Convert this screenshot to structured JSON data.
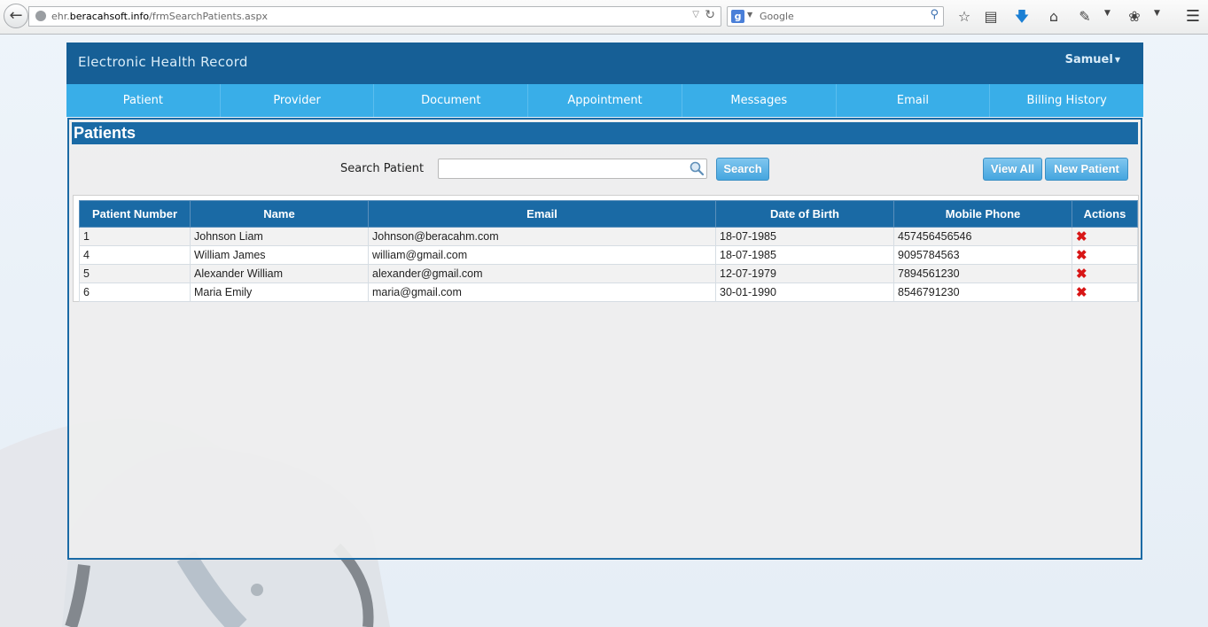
{
  "browser": {
    "url_prefix": "ehr.",
    "url_host": "beracahsoft.info",
    "url_path": "/frmSearchPatients.aspx",
    "search_engine_icon": "google-icon",
    "search_placeholder": "Google"
  },
  "header": {
    "title": "Electronic Health Record",
    "user": "Samuel"
  },
  "nav": {
    "items": [
      {
        "label": "Patient"
      },
      {
        "label": "Provider"
      },
      {
        "label": "Document"
      },
      {
        "label": "Appointment"
      },
      {
        "label": "Messages"
      },
      {
        "label": "Email"
      },
      {
        "label": "Billing History"
      }
    ]
  },
  "panel": {
    "title": "Patients",
    "search_label": "Search Patient",
    "search_value": "",
    "search_button": "Search",
    "view_all_button": "View All",
    "new_patient_button": "New Patient"
  },
  "table": {
    "headers": [
      "Patient Number",
      "Name",
      "Email",
      "Date of Birth",
      "Mobile Phone",
      "Actions"
    ],
    "rows": [
      {
        "number": "1",
        "name": "Johnson Liam",
        "email": "Johnson@beracahm.com",
        "dob": "18-07-1985",
        "phone": "457456456546"
      },
      {
        "number": "4",
        "name": "William James",
        "email": "william@gmail.com",
        "dob": "18-07-1985",
        "phone": "9095784563"
      },
      {
        "number": "5",
        "name": "Alexander William",
        "email": "alexander@gmail.com",
        "dob": "12-07-1979",
        "phone": "7894561230"
      },
      {
        "number": "6",
        "name": "Maria Emily",
        "email": "maria@gmail.com",
        "dob": "30-01-1990",
        "phone": "8546791230"
      }
    ],
    "delete_icon": "delete-x-icon"
  },
  "colors": {
    "header_bg": "#165f96",
    "nav_bg": "#39aee8",
    "table_header_bg": "#1a6aa5",
    "button_bg": "#45a6df",
    "delete_color": "#d81616"
  }
}
